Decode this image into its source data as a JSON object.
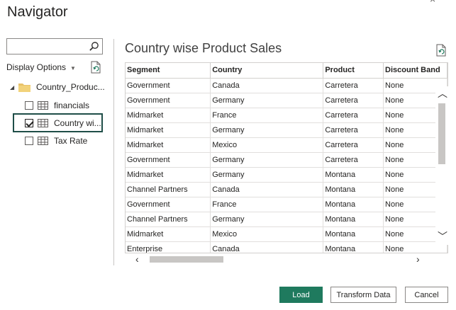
{
  "window": {
    "title": "Navigator",
    "close_glyph": "×"
  },
  "left_pane": {
    "search": {
      "value": "",
      "placeholder": "",
      "icon": "search-icon"
    },
    "display_options_label": "Display Options",
    "root": {
      "label": "Country_Produc...",
      "expanded": true
    },
    "items": [
      {
        "label": "financials",
        "checked": false
      },
      {
        "label": "Country wi...",
        "checked": true,
        "selected": true
      },
      {
        "label": "Tax Rate",
        "checked": false
      }
    ]
  },
  "preview": {
    "title": "Country wise Product Sales",
    "columns": [
      "Segment",
      "Country",
      "Product",
      "Discount Band"
    ],
    "rows": [
      [
        "Government",
        "Canada",
        "Carretera",
        "None"
      ],
      [
        "Government",
        "Germany",
        "Carretera",
        "None"
      ],
      [
        "Midmarket",
        "France",
        "Carretera",
        "None"
      ],
      [
        "Midmarket",
        "Germany",
        "Carretera",
        "None"
      ],
      [
        "Midmarket",
        "Mexico",
        "Carretera",
        "None"
      ],
      [
        "Government",
        "Germany",
        "Carretera",
        "None"
      ],
      [
        "Midmarket",
        "Germany",
        "Montana",
        "None"
      ],
      [
        "Channel Partners",
        "Canada",
        "Montana",
        "None"
      ],
      [
        "Government",
        "France",
        "Montana",
        "None"
      ],
      [
        "Channel Partners",
        "Germany",
        "Montana",
        "None"
      ],
      [
        "Midmarket",
        "Mexico",
        "Montana",
        "None"
      ],
      [
        "Enterprise",
        "Canada",
        "Montana",
        "None"
      ]
    ]
  },
  "buttons": {
    "load": "Load",
    "transform": "Transform Data",
    "cancel": "Cancel"
  },
  "colors": {
    "accent": "#1f7a5e",
    "selection_border": "#1f4e48"
  }
}
